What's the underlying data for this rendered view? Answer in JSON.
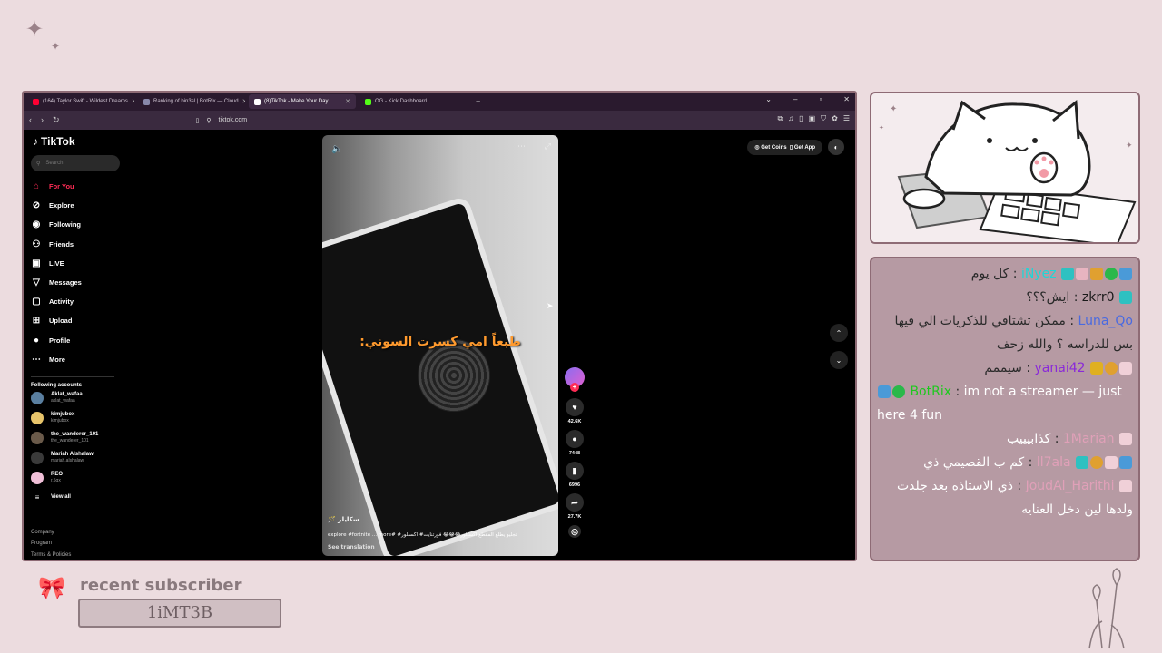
{
  "browser": {
    "tabs": [
      {
        "title": "(164) Taylor Swift - Wildest Dreams",
        "color": "#ff0033"
      },
      {
        "title": "Ranking of bin3sl | BotRix — Cloud",
        "color": "#8888aa"
      },
      {
        "title": "(8)TikTok - Make Your Day",
        "color": "#111111",
        "active": true
      },
      {
        "title": "OG - Kick Dashboard",
        "color": "#53fc18"
      }
    ],
    "url": "tiktok.com"
  },
  "tiktok": {
    "logo": "TikTok",
    "search_placeholder": "Search",
    "menu": [
      {
        "label": "For You",
        "icon": "home-icon"
      },
      {
        "label": "Explore",
        "icon": "compass-icon"
      },
      {
        "label": "Following",
        "icon": "following-icon"
      },
      {
        "label": "Friends",
        "icon": "friends-icon"
      },
      {
        "label": "LIVE",
        "icon": "live-icon"
      },
      {
        "label": "Messages",
        "icon": "messages-icon"
      },
      {
        "label": "Activity",
        "icon": "activity-icon"
      },
      {
        "label": "Upload",
        "icon": "upload-icon"
      },
      {
        "label": "Profile",
        "icon": "profile-icon"
      },
      {
        "label": "More",
        "icon": "more-icon"
      }
    ],
    "following_title": "Following accounts",
    "accounts": [
      {
        "name": "Aklat_wafaa",
        "handle": "aklat_wafaa",
        "color": "#5a7fa0"
      },
      {
        "name": "kimjubox",
        "handle": "kimjubox",
        "color": "#e7c46a"
      },
      {
        "name": "the_wanderer_101",
        "handle": "the_wanderer_101",
        "color": "#6a5a4a"
      },
      {
        "name": "Mariah Alshalawi",
        "handle": "mariah.alshalawi",
        "color": "#3a3a3a"
      },
      {
        "name": "REO",
        "handle": "r.5qx",
        "color": "#f0c0d8"
      }
    ],
    "view_all": "View all",
    "footer": [
      "Company",
      "Program",
      "Terms & Policies"
    ],
    "get_coins": "Get Coins",
    "get_app": "Get App",
    "video": {
      "caption": "طبعاً امي كسرت السوني:",
      "author": "سكايلر 🪄",
      "description": "تجليو يطلع المقطع اكسبلور😂😂😂 فورتنايت# اكسبلور# #explore #fortnite ... more",
      "see_translation": "See translation"
    },
    "actions": {
      "likes": "42.6K",
      "comments": "7448",
      "saves": "6996",
      "shares": "27.7K"
    }
  },
  "chat": {
    "messages": [
      {
        "user": "iNyez",
        "text": "كل يوم",
        "color": "#1fd6d6",
        "badges": [
          "#4a9ad8",
          "#2ab84a",
          "#e0a030",
          "#e8b4c0",
          "#2ec1c1"
        ],
        "ltr": false
      },
      {
        "user": "zkrr0",
        "text": "ايش؟؟؟",
        "color": "#1a1a1a",
        "badges": [
          "#2ec1c1"
        ],
        "ltr": false
      },
      {
        "user": "Luna_Qo",
        "text": "ممكن تشتاقي للذكريات الي فيها بس للدراسه ؟ والله زحف",
        "color": "#4a6ae0",
        "badges": [],
        "ltr": false
      },
      {
        "user": "yanai42",
        "text": "سيممم",
        "color": "#8a2ad8",
        "badges": [
          "#f0d0d8",
          "#e0a030",
          "#e0b020"
        ],
        "ltr": false
      },
      {
        "user": "BotRix",
        "text": "im not a streamer — just here 4 fun",
        "color": "#1fc81f",
        "badges": [
          "#4a9ad8",
          "#2ab84a"
        ],
        "ltr": true
      },
      {
        "user": "1Mariah",
        "text": "كذابيييب",
        "color": "#e0a0b8",
        "badges": [
          "#f0d0d8"
        ],
        "ltr": false
      },
      {
        "user": "ll7ala",
        "text": "كم ب القصيمي ذي",
        "color": "#e0a0b8",
        "badges": [
          "#4a9ad8",
          "#f0d0d8",
          "#e0a030",
          "#2ec1c1"
        ],
        "ltr": false
      },
      {
        "user": "JoudAl_Harithi",
        "text": "ذي الاستاذه بعد جلدت ولدها لين دخل العنايه",
        "color": "#e0a0b8",
        "badges": [
          "#f0d0d8"
        ],
        "ltr": false
      }
    ]
  },
  "recent_subscriber": {
    "title": "recent subscriber",
    "name": "1iMT3B"
  }
}
